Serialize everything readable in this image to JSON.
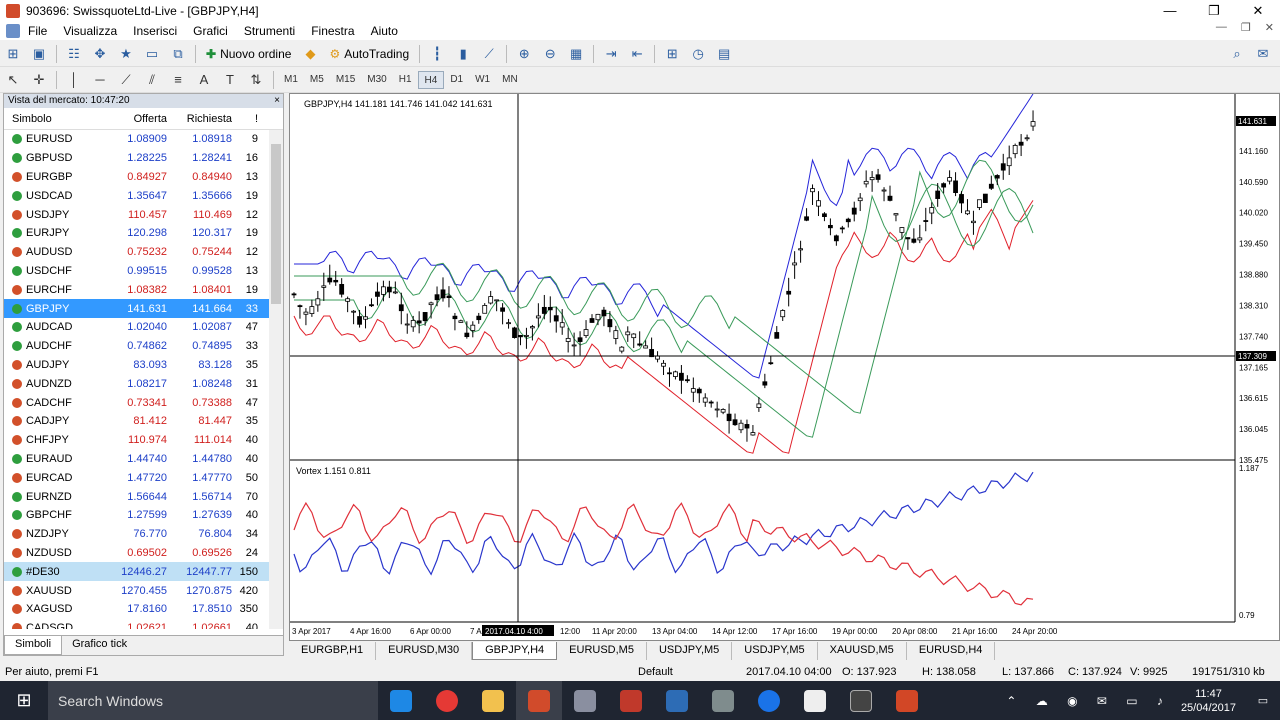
{
  "window": {
    "title": "903696: SwissquoteLtd-Live - [GBPJPY,H4]",
    "controls": [
      "—",
      "❐",
      "✕"
    ]
  },
  "menu": {
    "items": [
      "File",
      "Visualizza",
      "Inserisci",
      "Grafici",
      "Strumenti",
      "Finestra",
      "Aiuto"
    ]
  },
  "toolbar": {
    "new_order_label": "Nuovo ordine",
    "autotrading_label": "AutoTrading",
    "timeframes": [
      "M1",
      "M5",
      "M15",
      "M30",
      "H1",
      "H4",
      "D1",
      "W1",
      "MN"
    ],
    "active_timeframe": "H4"
  },
  "market_watch": {
    "title": "Vista del mercato: 10:47:20",
    "close": "×",
    "columns": [
      "Simbolo",
      "Offerta",
      "Richiesta",
      "!"
    ],
    "rows": [
      {
        "symbol": "EURUSD",
        "bid": "1.08909",
        "ask": "1.08918",
        "spread": "9",
        "dir": "up",
        "red": false
      },
      {
        "symbol": "GBPUSD",
        "bid": "1.28225",
        "ask": "1.28241",
        "spread": "16",
        "dir": "up",
        "red": false
      },
      {
        "symbol": "EURGBP",
        "bid": "0.84927",
        "ask": "0.84940",
        "spread": "13",
        "dir": "dn",
        "red": true
      },
      {
        "symbol": "USDCAD",
        "bid": "1.35647",
        "ask": "1.35666",
        "spread": "19",
        "dir": "up",
        "red": false
      },
      {
        "symbol": "USDJPY",
        "bid": "110.457",
        "ask": "110.469",
        "spread": "12",
        "dir": "dn",
        "red": true
      },
      {
        "symbol": "EURJPY",
        "bid": "120.298",
        "ask": "120.317",
        "spread": "19",
        "dir": "up",
        "red": false
      },
      {
        "symbol": "AUDUSD",
        "bid": "0.75232",
        "ask": "0.75244",
        "spread": "12",
        "dir": "dn",
        "red": true
      },
      {
        "symbol": "USDCHF",
        "bid": "0.99515",
        "ask": "0.99528",
        "spread": "13",
        "dir": "up",
        "red": false
      },
      {
        "symbol": "EURCHF",
        "bid": "1.08382",
        "ask": "1.08401",
        "spread": "19",
        "dir": "dn",
        "red": true
      },
      {
        "symbol": "GBPJPY",
        "bid": "141.631",
        "ask": "141.664",
        "spread": "33",
        "dir": "up",
        "red": false
      },
      {
        "symbol": "AUDCAD",
        "bid": "1.02040",
        "ask": "1.02087",
        "spread": "47",
        "dir": "up",
        "red": false
      },
      {
        "symbol": "AUDCHF",
        "bid": "0.74862",
        "ask": "0.74895",
        "spread": "33",
        "dir": "up",
        "red": false
      },
      {
        "symbol": "AUDJPY",
        "bid": "83.093",
        "ask": "83.128",
        "spread": "35",
        "dir": "dn",
        "red": false
      },
      {
        "symbol": "AUDNZD",
        "bid": "1.08217",
        "ask": "1.08248",
        "spread": "31",
        "dir": "dn",
        "red": false
      },
      {
        "symbol": "CADCHF",
        "bid": "0.73341",
        "ask": "0.73388",
        "spread": "47",
        "dir": "dn",
        "red": true
      },
      {
        "symbol": "CADJPY",
        "bid": "81.412",
        "ask": "81.447",
        "spread": "35",
        "dir": "dn",
        "red": true
      },
      {
        "symbol": "CHFJPY",
        "bid": "110.974",
        "ask": "111.014",
        "spread": "40",
        "dir": "dn",
        "red": true
      },
      {
        "symbol": "EURAUD",
        "bid": "1.44740",
        "ask": "1.44780",
        "spread": "40",
        "dir": "up",
        "red": false
      },
      {
        "symbol": "EURCAD",
        "bid": "1.47720",
        "ask": "1.47770",
        "spread": "50",
        "dir": "dn",
        "red": false
      },
      {
        "symbol": "EURNZD",
        "bid": "1.56644",
        "ask": "1.56714",
        "spread": "70",
        "dir": "up",
        "red": false
      },
      {
        "symbol": "GBPCHF",
        "bid": "1.27599",
        "ask": "1.27639",
        "spread": "40",
        "dir": "up",
        "red": false
      },
      {
        "symbol": "NZDJPY",
        "bid": "76.770",
        "ask": "76.804",
        "spread": "34",
        "dir": "dn",
        "red": false
      },
      {
        "symbol": "NZDUSD",
        "bid": "0.69502",
        "ask": "0.69526",
        "spread": "24",
        "dir": "dn",
        "red": true
      },
      {
        "symbol": "#DE30",
        "bid": "12446.27",
        "ask": "12447.77",
        "spread": "150",
        "dir": "up",
        "red": false
      },
      {
        "symbol": "XAUUSD",
        "bid": "1270.455",
        "ask": "1270.875",
        "spread": "420",
        "dir": "dn",
        "red": false
      },
      {
        "symbol": "XAGUSD",
        "bid": "17.8160",
        "ask": "17.8510",
        "spread": "350",
        "dir": "dn",
        "red": false
      },
      {
        "symbol": "CADSGD",
        "bid": "1.02621",
        "ask": "1.02661",
        "spread": "40",
        "dir": "dn",
        "red": true
      }
    ],
    "selected_index": 9,
    "highlighted_index": 23,
    "tabs": [
      "Simboli",
      "Grafico tick"
    ]
  },
  "chart": {
    "header": "GBPJPY,H4  141.181 141.746 141.042 141.631",
    "price_labels": [
      "141.720",
      "141.160",
      "140.590",
      "140.020",
      "139.450",
      "138.880",
      "138.310",
      "137.740",
      "137.165",
      "136.615",
      "136.045",
      "135.475"
    ],
    "current_price": "141.631",
    "crosshair_price": "137.309",
    "indicator_header": "Vortex 1.151 0.811",
    "indicator_labels": [
      "1.187",
      "0.79"
    ],
    "time_labels": [
      "3 Apr 2017",
      "4 Apr 16:00",
      "6 Apr 00:00",
      "7 A",
      "12:00",
      "11 Apr 20:00",
      "13 Apr 04:00",
      "14 Apr 12:00",
      "17 Apr 16:00",
      "19 Apr 00:00",
      "20 Apr 08:00",
      "21 Apr 16:00",
      "24 Apr 20:00"
    ],
    "crosshair_time": "2017.04.10 4:00",
    "colors": {
      "bull": "#000000",
      "bear": "#000000",
      "band_up": "#2626d9",
      "band_dn": "#e0202a",
      "ma": "#3a9a5a",
      "vortex_plus": "#2a36cc",
      "vortex_minus": "#e0303a"
    }
  },
  "chart_tabs": [
    "EURGBP,H1",
    "EURUSD,M30",
    "GBPJPY,H4",
    "EURUSD,M5",
    "USDJPY,M5",
    "USDJPY,M5",
    "XAUUSD,M5",
    "EURUSD,H4"
  ],
  "active_chart_tab": 2,
  "status": {
    "help": "Per aiuto, premi F1",
    "profile": "Default",
    "datetime": "2017.04.10 04:00",
    "open": "O: 137.923",
    "high": "H: 138.058",
    "low": "L: 137.866",
    "close": "C: 137.924",
    "volume": "V: 9925",
    "traffic": "191751/310 kb"
  },
  "taskbar": {
    "search_placeholder": "Search Windows",
    "time": "11:47",
    "date": "25/04/2017"
  }
}
